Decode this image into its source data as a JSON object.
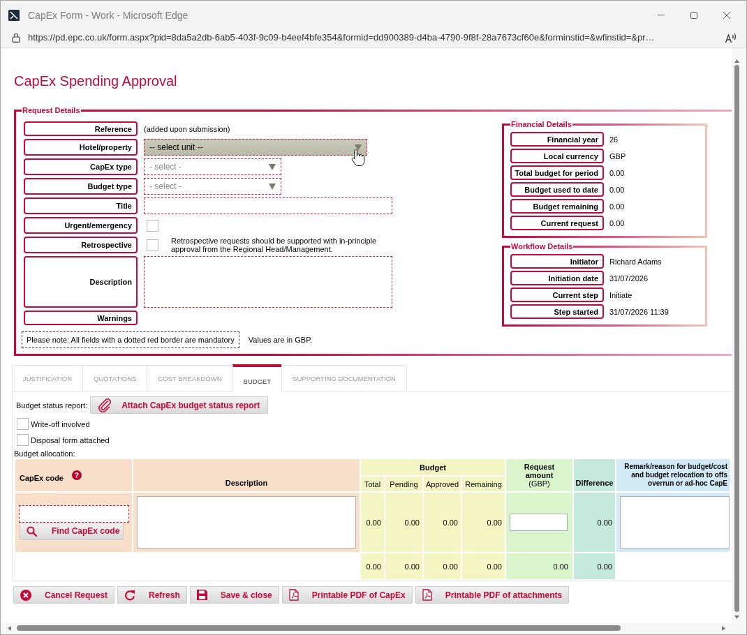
{
  "window": {
    "title": "CapEx Form - Work - Microsoft Edge"
  },
  "address_bar": {
    "url": "https://pd.epc.co.uk/form.aspx?pid=8da5a2db-6ab5-403f-9c09-b4eef4bfe354&formid=dd900389-d4ba-4790-9f8f-28a7673cf60e&forminstid=&wfinstid=&pr…"
  },
  "page_title": "CapEx Spending Approval",
  "request_details": {
    "legend": "Request Details",
    "rows": [
      {
        "kind": "text",
        "label": "Reference",
        "value": "(added upon submission)"
      },
      {
        "kind": "select",
        "label": "Hotel/property",
        "value": "-- select unit --",
        "required": true,
        "hovered": true
      },
      {
        "kind": "select",
        "label": "CapEx type",
        "value": "- select -",
        "required": true,
        "hovered": false
      },
      {
        "kind": "select",
        "label": "Budget type",
        "value": "- select -",
        "required": true,
        "hovered": false
      },
      {
        "kind": "input",
        "label": "Title",
        "required": true
      },
      {
        "kind": "checkbox",
        "label": "Urgent/emergency",
        "checked": false
      },
      {
        "kind": "checkbox",
        "label": "Retrospective",
        "checked": false,
        "note": "Retrospective requests should be supported with in-principle approval from the Regional Head/Management."
      },
      {
        "kind": "textarea",
        "label": "Description",
        "required": true
      },
      {
        "kind": "empty",
        "label": "Warnings"
      }
    ],
    "mandatory_note": "Please note: All fields with a dotted red border are mandatory",
    "currency_note": "Values are in GBP."
  },
  "financial_details": {
    "legend": "Financial Details",
    "rows": [
      {
        "label": "Financial year",
        "value": "26"
      },
      {
        "label": "Local currency",
        "value": "GBP"
      },
      {
        "label": "Total budget for period",
        "value": "0.00"
      },
      {
        "label": "Budget used to date",
        "value": "0.00"
      },
      {
        "label": "Budget remaining",
        "value": "0.00"
      },
      {
        "label": "Current request",
        "value": "0.00"
      }
    ]
  },
  "workflow_details": {
    "legend": "Workflow Details",
    "rows": [
      {
        "label": "Initiator",
        "value": "Richard Adams"
      },
      {
        "label": "Initiation date",
        "value": "31/07/2026"
      },
      {
        "label": "Current step",
        "value": "Initiate"
      },
      {
        "label": "Step started",
        "value": "31/07/2026 11:39"
      }
    ]
  },
  "tabs": [
    {
      "label": "JUSTIFICATION",
      "selected": false
    },
    {
      "label": "QUOTATIONS",
      "selected": false
    },
    {
      "label": "COST BREAKDOWN",
      "selected": false
    },
    {
      "label": "BUDGET",
      "selected": true
    },
    {
      "label": "SUPPORTING DOCUMENTATION",
      "selected": false
    }
  ],
  "budget_tab": {
    "status_report_label": "Budget status report:",
    "attach_button": "Attach CapEx budget status report",
    "checkboxes": [
      {
        "label": "Write-off involved",
        "checked": false
      },
      {
        "label": "Disposal form attached",
        "checked": false
      }
    ],
    "allocation_label": "Budget allocation:",
    "table": {
      "columns": [
        {
          "kind": "code",
          "header": "CapEx code",
          "help_icon": "?"
        },
        {
          "kind": "description",
          "header": "Description"
        },
        {
          "kind": "budget",
          "header": "Budget",
          "subcolumns": [
            "Total",
            "Pending",
            "Approved",
            "Remaining"
          ]
        },
        {
          "kind": "request",
          "header_lines": [
            "**Request**",
            "**amount**",
            "(GBP)"
          ]
        },
        {
          "kind": "difference",
          "header": "Difference"
        },
        {
          "kind": "remark",
          "header_lines": [
            "Remark/reason for budget/cost",
            "and budget relocation to offs",
            "overrun or ad-hoc CapE"
          ]
        }
      ],
      "entry_row": {
        "code_required": true,
        "find_button": "Find CapEx code",
        "budget": [
          "0.00",
          "0.00",
          "0.00",
          "0.00"
        ],
        "difference": "0.00"
      },
      "totals_row": {
        "budget": [
          "0.00",
          "0.00",
          "0.00",
          "0.00"
        ],
        "request": "0.00",
        "difference": "0.00"
      }
    }
  },
  "buttons": [
    {
      "kind": "cancel",
      "label": "Cancel Request"
    },
    {
      "kind": "refresh",
      "label": "Refresh"
    },
    {
      "kind": "save",
      "label": "Save & close"
    },
    {
      "kind": "pdf",
      "label": "Printable PDF of CapEx"
    },
    {
      "kind": "pdf",
      "label": "Printable PDF of attachments"
    }
  ]
}
